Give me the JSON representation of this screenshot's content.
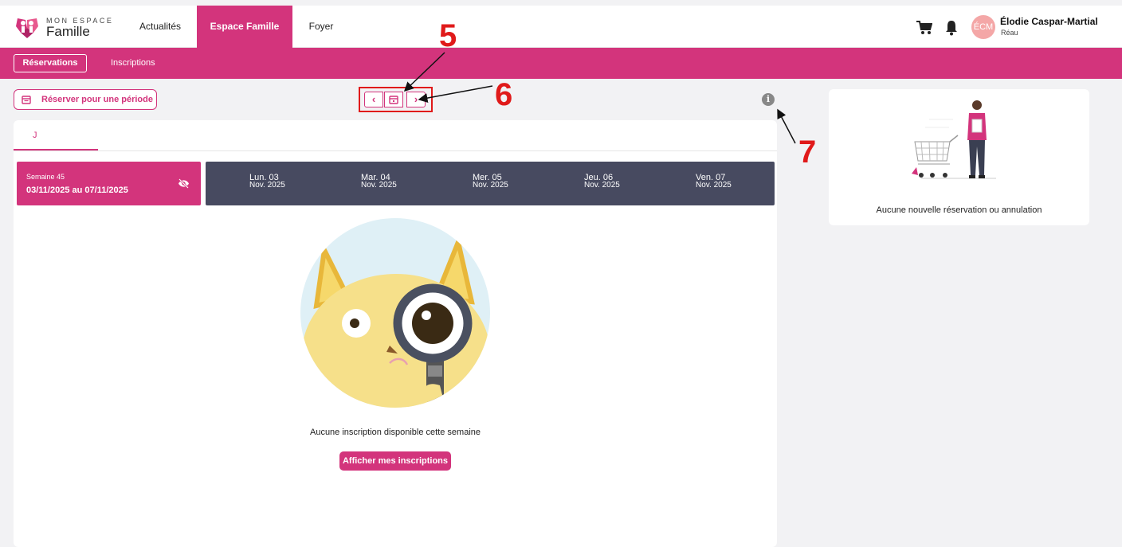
{
  "header": {
    "logo_line1": "MON ESPACE",
    "logo_line2": "Famille",
    "nav": [
      "Actualités",
      "Espace Famille",
      "Foyer"
    ],
    "active_nav": "Espace Famille",
    "user": {
      "initials": "ÉCM",
      "name": "Élodie Caspar-Martial",
      "city": "Réau"
    }
  },
  "subnav": {
    "tabs": [
      "Réservations",
      "Inscriptions"
    ],
    "active": "Réservations"
  },
  "toolbar": {
    "reserve_period_label": "Réserver pour une période",
    "prev": "‹",
    "next": "›"
  },
  "annotations": [
    "5",
    "6",
    "7"
  ],
  "main": {
    "child_tab": "J",
    "week": {
      "label": "Semaine 45",
      "range": "03/11/2025 au 07/11/2025"
    },
    "days": [
      {
        "day": "Lun. 03",
        "month": "Nov. 2025"
      },
      {
        "day": "Mar. 04",
        "month": "Nov. 2025"
      },
      {
        "day": "Mer. 05",
        "month": "Nov. 2025"
      },
      {
        "day": "Jeu. 06",
        "month": "Nov. 2025"
      },
      {
        "day": "Ven. 07",
        "month": "Nov. 2025"
      }
    ],
    "empty_message": "Aucune inscription disponible cette semaine",
    "show_button": "Afficher mes inscriptions"
  },
  "side": {
    "message": "Aucune nouvelle réservation ou annulation"
  },
  "colors": {
    "brand": "#d3347c",
    "days_bar": "#474a60",
    "annotation": "#e01a1a"
  }
}
